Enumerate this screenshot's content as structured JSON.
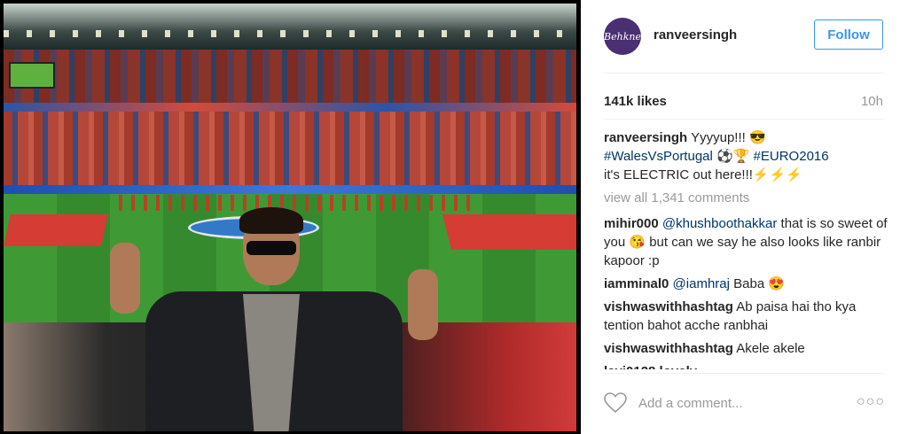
{
  "photo": {
    "description_icon": "stadium-photo"
  },
  "header": {
    "avatar_text": "Behkne",
    "username": "ranveersingh",
    "follow_label": "Follow"
  },
  "stats": {
    "likes": "141k likes",
    "time": "10h"
  },
  "caption": {
    "author": "ranveersingh",
    "text1": " Yyyyup!!! 😎",
    "hashtag1": "#WalesVsPortugal",
    "emoji": " ⚽🏆 ",
    "hashtag2": "#EURO2016",
    "text2": "it's ELECTRIC out here!!!⚡⚡⚡"
  },
  "view_all": "view all 1,341 comments",
  "comments": [
    {
      "author": "mihir000",
      "mention": "@khushboothakkar",
      "text": " that is so sweet of you 😘 but can we say he also looks like ranbir kapoor :p"
    },
    {
      "author": "iamminal0",
      "mention": "@iamhraj",
      "text": " Baba 😍"
    },
    {
      "author": "vishwaswithhashtag",
      "mention": "",
      "text": " Ab paisa hai tho kya tention bahot acche ranbhai"
    },
    {
      "author": "vishwaswithhashtag",
      "mention": "",
      "text": " Akele akele"
    }
  ],
  "partial_comment": "lavi0128 lovely",
  "footer": {
    "placeholder": "Add a comment...",
    "more": "○○○"
  }
}
